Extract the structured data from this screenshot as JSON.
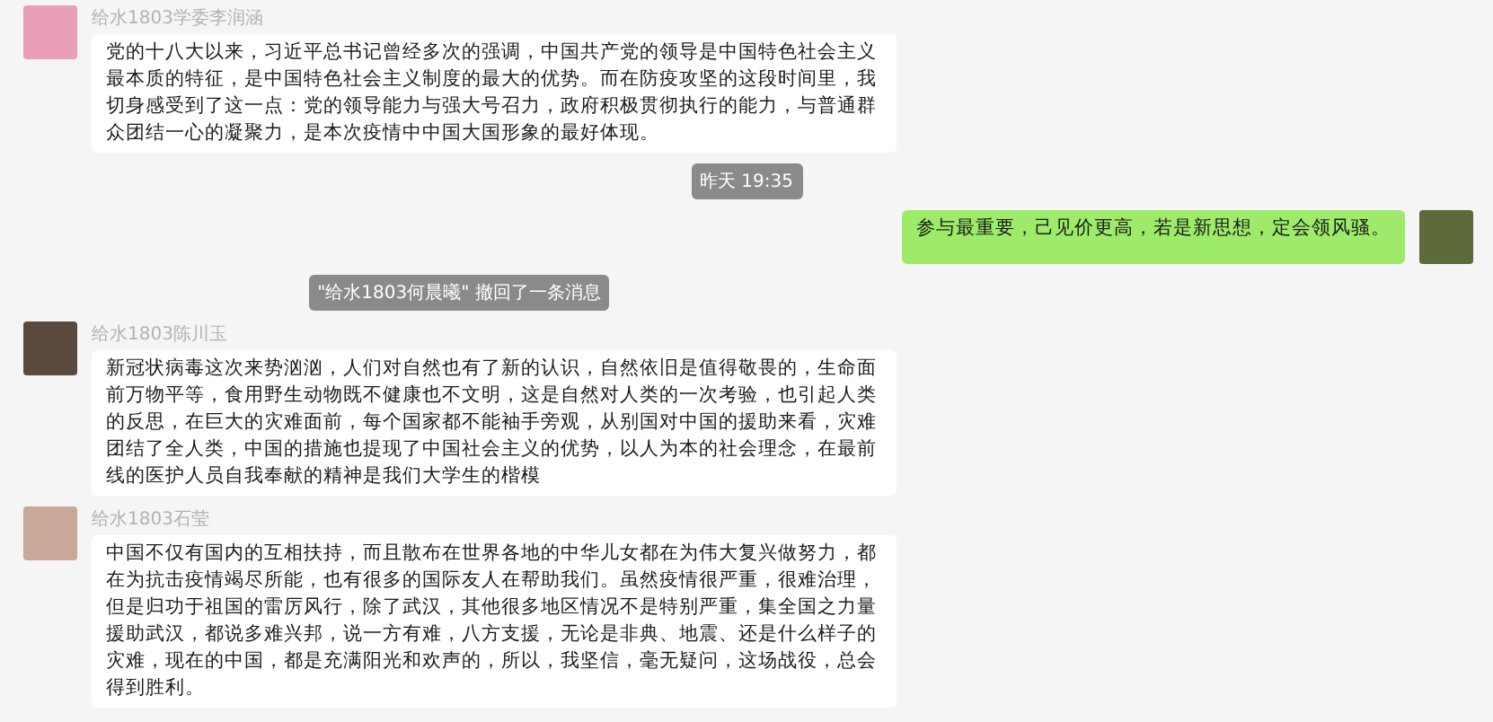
{
  "messages": [
    {
      "kind": "incoming",
      "sender": "给水1803学委李润涵",
      "text": "党的十八大以来，习近平总书记曾经多次的强调，中国共产党的领导是中国特色社会主义最本质的特征，是中国特色社会主义制度的最大的优势。而在防疫攻坚的这段时间里，我切身感受到了这一点：党的领导能力与强大号召力，政府积极贯彻执行的能力，与普通群众团结一心的凝聚力，是本次疫情中中国大国形象的最好体现。"
    },
    {
      "kind": "time",
      "text": "昨天 19:35"
    },
    {
      "kind": "outgoing",
      "text": "参与最重要，己见价更高，若是新思想，定会领风骚。"
    },
    {
      "kind": "notice",
      "text": "\"给水1803何晨曦\" 撤回了一条消息"
    },
    {
      "kind": "incoming",
      "sender": "给水1803陈川玉",
      "text": "新冠状病毒这次来势汹汹，人们对自然也有了新的认识，自然依旧是值得敬畏的，生命面前万物平等，食用野生动物既不健康也不文明，这是自然对人类的一次考验，也引起人类的反思，在巨大的灾难面前，每个国家都不能袖手旁观，从别国对中国的援助来看，灾难团结了全人类，中国的措施也提现了中国社会主义的优势，以人为本的社会理念，在最前线的医护人员自我奉献的精神是我们大学生的楷模"
    },
    {
      "kind": "incoming",
      "sender": "给水1803石莹",
      "text": "中国不仅有国内的互相扶持，而且散布在世界各地的中华儿女都在为伟大复兴做努力，都在为抗击疫情竭尽所能，也有很多的国际友人在帮助我们。虽然疫情很严重，很难治理，但是归功于祖国的雷厉风行，除了武汉，其他很多地区情况不是特别严重，集全国之力量援助武汉，都说多难兴邦，说一方有难，八方支援，无论是非典、地震、还是什么样子的灾难，现在的中国，都是充满阳光和欢声的，所以，我坚信，毫无疑问，这场战役，总会得到胜利。"
    }
  ]
}
